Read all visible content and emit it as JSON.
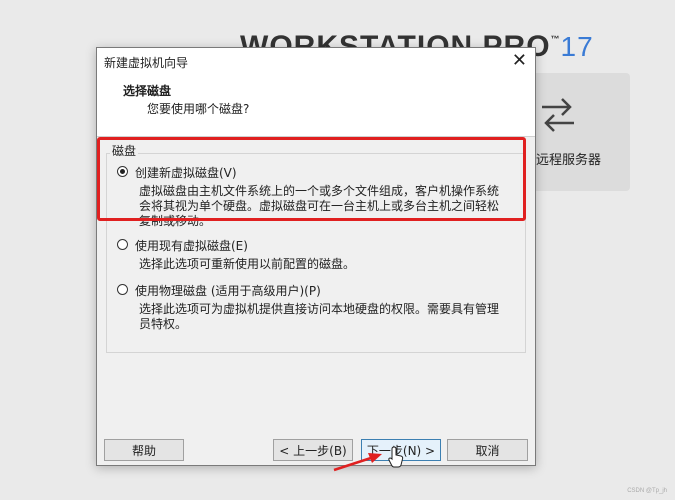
{
  "background": {
    "brand": "WORKSTATION PRO",
    "tm": "™",
    "version": "17",
    "card_label": "远程服务器",
    "watermark": "CSDN @Tp_jh"
  },
  "dialog": {
    "title": "新建虚拟机向导",
    "header_title": "选择磁盘",
    "header_subtitle": "您要使用哪个磁盘?",
    "group_label": "磁盘",
    "options": [
      {
        "label": "创建新虚拟磁盘(V)",
        "selected": true,
        "desc": "虚拟磁盘由主机文件系统上的一个或多个文件组成，客户机操作系统会将其视为单个硬盘。虚拟磁盘可在一台主机上或多台主机之间轻松复制或移动。"
      },
      {
        "label": "使用现有虚拟磁盘(E)",
        "selected": false,
        "desc": "选择此选项可重新使用以前配置的磁盘。"
      },
      {
        "label": "使用物理磁盘 (适用于高级用户)(P)",
        "selected": false,
        "desc": "选择此选项可为虚拟机提供直接访问本地硬盘的权限。需要具有管理员特权。"
      }
    ],
    "buttons": {
      "help": "帮助",
      "back": "< 上一步(B)",
      "next": "下一步(N) >",
      "cancel": "取消"
    }
  },
  "colors": {
    "highlight": "#e02020",
    "accent": "#3a7bd5"
  },
  "icons": {
    "close": "close-icon",
    "card": "swap-arrows-icon",
    "annotation": "red-arrow-icon",
    "cursor": "mouse-cursor-icon"
  }
}
